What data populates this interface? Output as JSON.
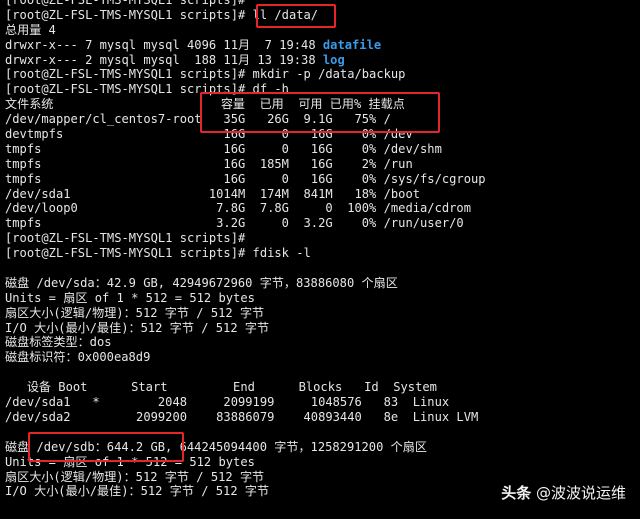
{
  "terminal": {
    "prompt": "[root@ZL-FSL-TMS-MYSQL1 scripts]#",
    "lines": [
      {
        "type": "prompt",
        "cmd": ""
      },
      {
        "type": "prompt",
        "cmd": " ll /data/"
      },
      {
        "type": "text",
        "text": "总用量 4"
      },
      {
        "type": "ls",
        "text": "drwxr-x--- 7 mysql mysql 4096 11月  7 19:48 ",
        "name": "datafile"
      },
      {
        "type": "ls",
        "text": "drwxr-x--- 2 mysql mysql  188 11月 13 19:38 ",
        "name": "log"
      },
      {
        "type": "prompt",
        "cmd": " mkdir -p /data/backup"
      },
      {
        "type": "prompt",
        "cmd": " df -h"
      },
      {
        "type": "text",
        "text": "文件系统                       容量  已用  可用 已用% 挂载点"
      },
      {
        "type": "text",
        "text": "/dev/mapper/cl_centos7-root   35G   26G  9.1G   75% /"
      },
      {
        "type": "text",
        "text": "devtmpfs                      16G     0   16G    0% /dev"
      },
      {
        "type": "text",
        "text": "tmpfs                         16G     0   16G    0% /dev/shm"
      },
      {
        "type": "text",
        "text": "tmpfs                         16G  185M   16G    2% /run"
      },
      {
        "type": "text",
        "text": "tmpfs                         16G     0   16G    0% /sys/fs/cgroup"
      },
      {
        "type": "text",
        "text": "/dev/sda1                   1014M  174M  841M   18% /boot"
      },
      {
        "type": "text",
        "text": "/dev/loop0                   7.8G  7.8G     0  100% /media/cdrom"
      },
      {
        "type": "text",
        "text": "tmpfs                        3.2G     0  3.2G    0% /run/user/0"
      },
      {
        "type": "prompt",
        "cmd": ""
      },
      {
        "type": "prompt",
        "cmd": " fdisk -l"
      },
      {
        "type": "text",
        "text": ""
      },
      {
        "type": "text",
        "text": "磁盘 /dev/sda：42.9 GB, 42949672960 字节，83886080 个扇区"
      },
      {
        "type": "text",
        "text": "Units = 扇区 of 1 * 512 = 512 bytes"
      },
      {
        "type": "text",
        "text": "扇区大小(逻辑/物理)：512 字节 / 512 字节"
      },
      {
        "type": "text",
        "text": "I/O 大小(最小/最佳)：512 字节 / 512 字节"
      },
      {
        "type": "text",
        "text": "磁盘标签类型：dos"
      },
      {
        "type": "text",
        "text": "磁盘标识符：0x000ea8d9"
      },
      {
        "type": "text",
        "text": ""
      },
      {
        "type": "text",
        "text": "   设备 Boot      Start         End      Blocks   Id  System"
      },
      {
        "type": "text",
        "text": "/dev/sda1   *        2048     2099199     1048576   83  Linux"
      },
      {
        "type": "text",
        "text": "/dev/sda2         2099200    83886079    40893440   8e  Linux LVM"
      },
      {
        "type": "text",
        "text": ""
      },
      {
        "type": "text",
        "text": "磁盘 /dev/sdb：644.2 GB, 644245094400 字节，1258291200 个扇区"
      },
      {
        "type": "text",
        "text": "Units = 扇区 of 1 * 512 = 512 bytes"
      },
      {
        "type": "text",
        "text": "扇区大小(逻辑/物理)：512 字节 / 512 字节"
      },
      {
        "type": "text",
        "text": "I/O 大小(最小/最佳)：512 字节 / 512 字节"
      }
    ]
  },
  "highlights": [
    "ll-data-command",
    "df-root-usage",
    "sdb-disk-size"
  ],
  "colors": {
    "background": "#000000",
    "text": "#e6e6e6",
    "directory": "#3b9be8",
    "highlight_border": "#e3262a"
  },
  "watermark": {
    "brand": "头条",
    "handle": "@波波说运维"
  }
}
